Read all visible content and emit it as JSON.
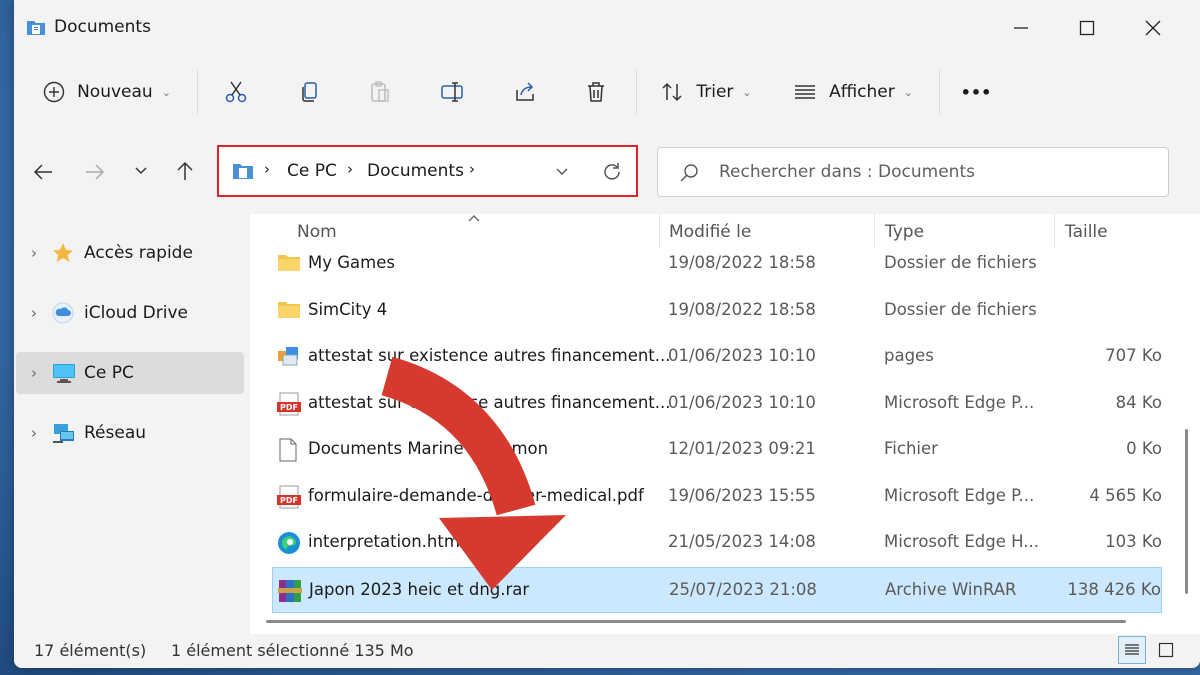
{
  "window": {
    "title": "Documents"
  },
  "toolbar": {
    "new_label": "Nouveau",
    "sort_label": "Trier",
    "view_label": "Afficher",
    "more_label": "•••"
  },
  "address": {
    "segments": [
      "Ce PC",
      "Documents"
    ]
  },
  "search": {
    "placeholder": "Rechercher dans : Documents"
  },
  "sidebar": {
    "items": [
      {
        "label": "Accès rapide",
        "icon": "star-icon"
      },
      {
        "label": "iCloud Drive",
        "icon": "icloud-icon"
      },
      {
        "label": "Ce PC",
        "icon": "computer-icon",
        "selected": true
      },
      {
        "label": "Réseau",
        "icon": "network-icon"
      }
    ]
  },
  "columns": {
    "name": "Nom",
    "modified": "Modifié le",
    "type": "Type",
    "size": "Taille"
  },
  "files": [
    {
      "name": "My Games",
      "date": "19/08/2022 18:58",
      "type": "Dossier de fichiers",
      "size": "",
      "icon": "folder-icon"
    },
    {
      "name": "SimCity 4",
      "date": "19/08/2022 18:58",
      "type": "Dossier de fichiers",
      "size": "",
      "icon": "folder-icon"
    },
    {
      "name": "attestat sur existence autres financement...",
      "date": "01/06/2023 10:10",
      "type": "pages",
      "size": "707 Ko",
      "icon": "pages-icon"
    },
    {
      "name": "attestat sur existence autres financement...",
      "date": "01/06/2023 10:10",
      "type": "Microsoft Edge P...",
      "size": "84 Ko",
      "icon": "pdf-icon"
    },
    {
      "name": "Documents Marine Pettamon",
      "date": "12/01/2023 09:21",
      "type": "Fichier",
      "size": "0 Ko",
      "icon": "file-icon"
    },
    {
      "name": "formulaire-demande-dossier-medical.pdf",
      "date": "19/06/2023 15:55",
      "type": "Microsoft Edge P...",
      "size": "4 565 Ko",
      "icon": "pdf-icon"
    },
    {
      "name": "interpretation.htm",
      "date": "21/05/2023 14:08",
      "type": "Microsoft Edge H...",
      "size": "103 Ko",
      "icon": "edge-icon"
    },
    {
      "name": "Japon 2023 heic et dng.rar",
      "date": "25/07/2023 21:08",
      "type": "Archive WinRAR",
      "size": "138 426 Ko",
      "icon": "winrar-icon",
      "selected": true
    }
  ],
  "status": {
    "count": "17 élément(s)",
    "selection": "1 élément sélectionné  135 Mo"
  },
  "colors": {
    "accent": "#0067c0",
    "selection_bg": "#cce8ff",
    "highlight_border": "#d9252b",
    "arrow": "#d63a2f"
  }
}
